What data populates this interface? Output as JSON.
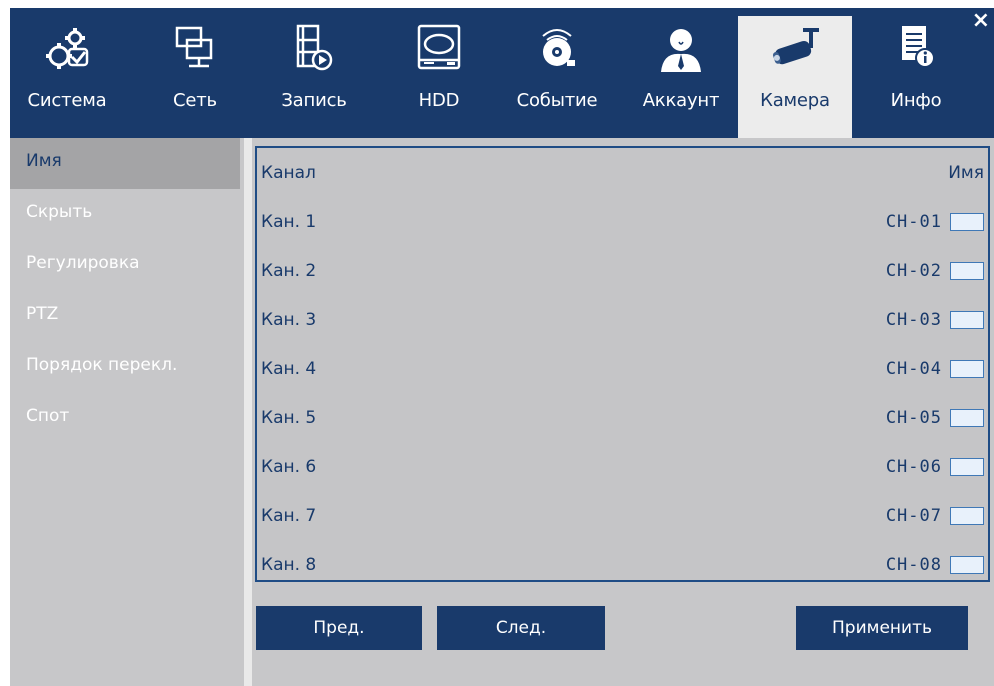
{
  "tabs": [
    {
      "label": "Система",
      "icon": "gears-icon"
    },
    {
      "label": "Сеть",
      "icon": "network-icon"
    },
    {
      "label": "Запись",
      "icon": "record-film-icon"
    },
    {
      "label": "HDD",
      "icon": "hdd-icon"
    },
    {
      "label": "Событие",
      "icon": "alarm-icon"
    },
    {
      "label": "Аккаунт",
      "icon": "user-icon"
    },
    {
      "label": "Камера",
      "icon": "camera-icon"
    },
    {
      "label": "Инфо",
      "icon": "info-icon"
    }
  ],
  "close_label": "×",
  "sidebar": {
    "items": [
      {
        "label": "Имя"
      },
      {
        "label": "Скрыть"
      },
      {
        "label": "Регулировка"
      },
      {
        "label": "PTZ"
      },
      {
        "label": "Порядок перекл."
      },
      {
        "label": "Спот"
      }
    ]
  },
  "table": {
    "headers": {
      "channel": "Канал",
      "name": "Имя"
    },
    "rows": [
      {
        "channel": "Кан. 1",
        "name": "CH-01"
      },
      {
        "channel": "Кан. 2",
        "name": "CH-02"
      },
      {
        "channel": "Кан. 3",
        "name": "CH-03"
      },
      {
        "channel": "Кан. 4",
        "name": "CH-04"
      },
      {
        "channel": "Кан. 5",
        "name": "CH-05"
      },
      {
        "channel": "Кан. 6",
        "name": "CH-06"
      },
      {
        "channel": "Кан. 7",
        "name": "CH-07"
      },
      {
        "channel": "Кан. 8",
        "name": "CH-08"
      }
    ]
  },
  "buttons": {
    "prev": "Пред.",
    "next": "След.",
    "apply": "Применить"
  },
  "colors": {
    "accent": "#193a6b",
    "background": "#c7c7c9",
    "active_tab": "#ececec"
  }
}
